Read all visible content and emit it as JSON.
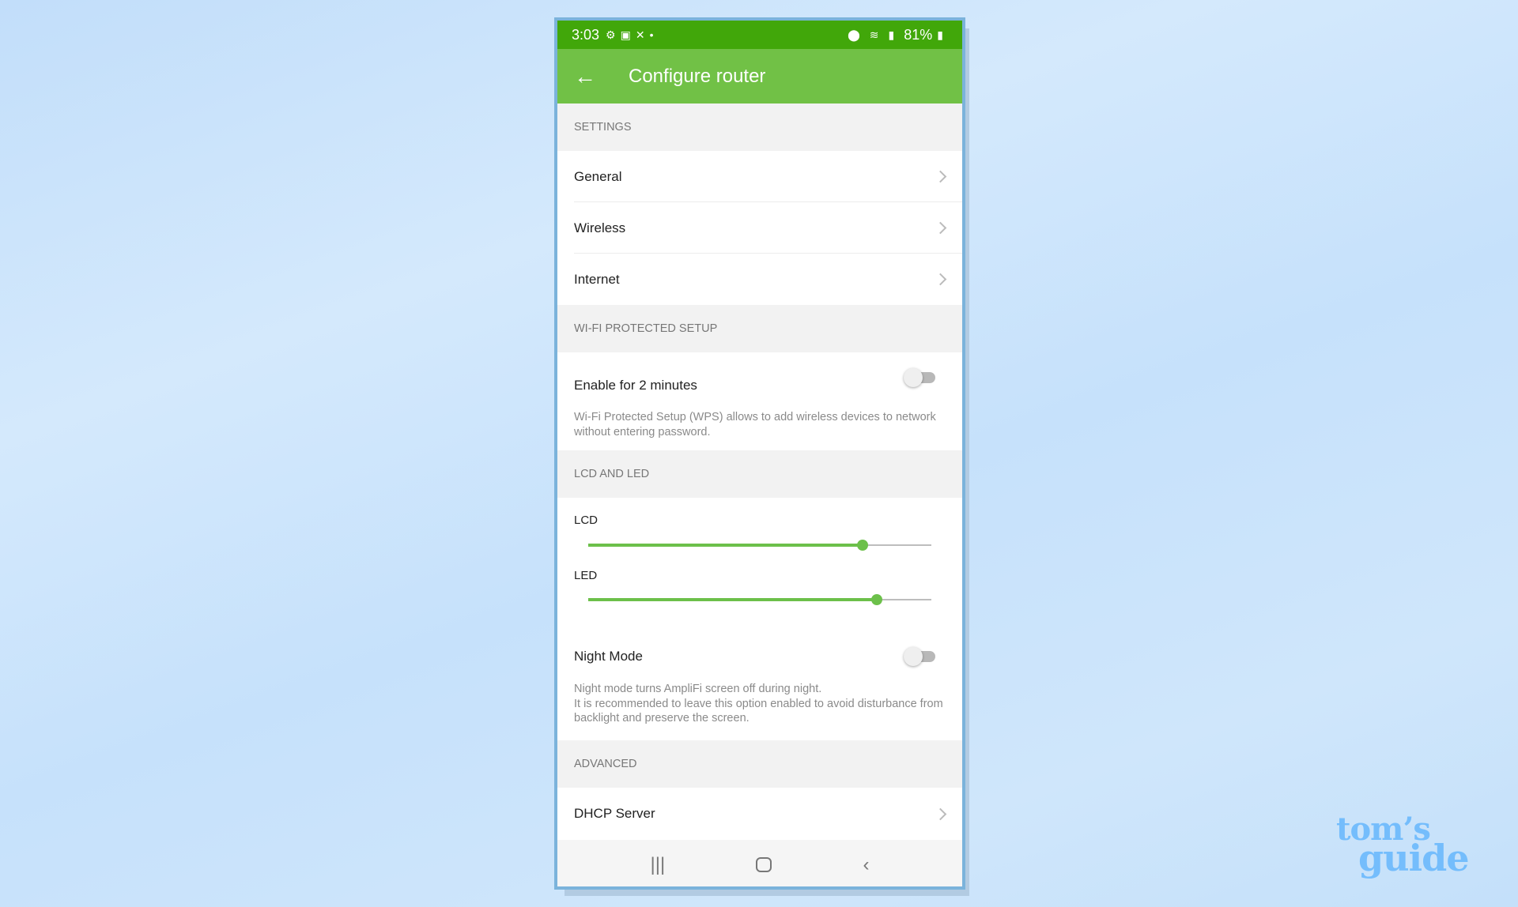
{
  "status_bar": {
    "time": "3:03",
    "battery": "81%",
    "icons": [
      "gear-icon",
      "voicemail-icon",
      "missed-call-icon",
      "dot-icon",
      "location-icon",
      "wifi-icon",
      "signal-icon",
      "battery-icon"
    ]
  },
  "app_bar": {
    "title": "Configure router",
    "back_icon": "arrow-left-icon"
  },
  "sections": {
    "settings": {
      "header": "SETTINGS",
      "items": [
        "General",
        "Wireless",
        "Internet"
      ]
    },
    "wps": {
      "header": "WI-FI PROTECTED SETUP",
      "toggle_label": "Enable for 2 minutes",
      "toggle_on": false,
      "description": "Wi-Fi Protected Setup (WPS) allows to add wireless devices to network without entering password."
    },
    "lcd_led": {
      "header": "LCD AND LED",
      "lcd_label": "LCD",
      "lcd_value": 0.8,
      "led_label": "LED",
      "led_value": 0.84,
      "night_label": "Night Mode",
      "night_on": false,
      "night_description_1": "Night mode turns AmpliFi screen off during night.",
      "night_description_2": "It is recommended to leave this option enabled to avoid disturbance from backlight and preserve the screen."
    },
    "advanced": {
      "header": "ADVANCED",
      "items": [
        "DHCP Server"
      ]
    }
  },
  "colors": {
    "status_bar": "#41a70a",
    "app_bar": "#71c146",
    "accent": "#6cc04a"
  },
  "nav_bar": {
    "icons": [
      "recents-icon",
      "home-icon",
      "back-icon"
    ]
  },
  "watermark": {
    "line1": "tom’s",
    "line2": "guide"
  }
}
